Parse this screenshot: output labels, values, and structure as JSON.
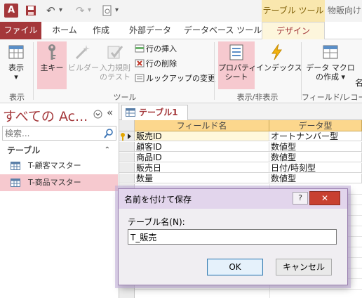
{
  "titlebar": {
    "app_icon": "A",
    "tool_tab": "テーブル ツール",
    "title": "物販向け",
    "qat_icons": [
      "save-icon",
      "undo-icon",
      "redo-icon",
      "print-preview-icon"
    ]
  },
  "tabs": [
    "ファイル",
    "ホーム",
    "作成",
    "外部データ",
    "データベース ツール",
    "デザイン"
  ],
  "ribbon": {
    "view_label": "表示",
    "primary_key_label": "主キー",
    "builder_label": "ビルダー",
    "validation_line1": "入力規則",
    "validation_line2": "のテスト",
    "insert_rows": "行の挿入",
    "delete_rows": "行の削除",
    "modify_lookups": "ルックアップの変更",
    "property_line1": "プロパティ",
    "property_line2": "シート",
    "indexes_label": "インデックス",
    "macro_line1": "データ マクロ",
    "macro_line2": "の作成 ▾",
    "cut_off_label": "名",
    "groups": {
      "views": "表示",
      "tools": "ツール",
      "show_hide": "表示/非表示",
      "field_events": "フィールド/レコード/"
    }
  },
  "nav": {
    "title": "すべての Ac...",
    "search_placeholder": "検索...",
    "section": "テーブル",
    "items": [
      {
        "label": "T-顧客マスター",
        "selected": false
      },
      {
        "label": "T-商品マスター",
        "selected": true
      }
    ]
  },
  "doc": {
    "tab_label": "テーブル1",
    "col_field": "フィールド名",
    "col_type": "データ型",
    "rows": [
      {
        "field": "販売ID",
        "type": "オートナンバー型",
        "primary_key": true
      },
      {
        "field": "顧客ID",
        "type": "数値型",
        "primary_key": false
      },
      {
        "field": "商品ID",
        "type": "数値型",
        "primary_key": false
      },
      {
        "field": "販売日",
        "type": "日付/時刻型",
        "primary_key": false
      },
      {
        "field": "数量",
        "type": "数値型",
        "primary_key": false
      }
    ]
  },
  "dialog": {
    "title": "名前を付けて保存",
    "help": "?",
    "close": "✕",
    "label": "テーブル名(N):",
    "value": "T_販売",
    "ok": "OK",
    "cancel": "キャンセル"
  },
  "colors": {
    "accent": "#a4373a",
    "header_fill": "#fcd78d",
    "selected_fill": "#f6c9cf",
    "tool_tab_fill": "#f9e7ae"
  }
}
